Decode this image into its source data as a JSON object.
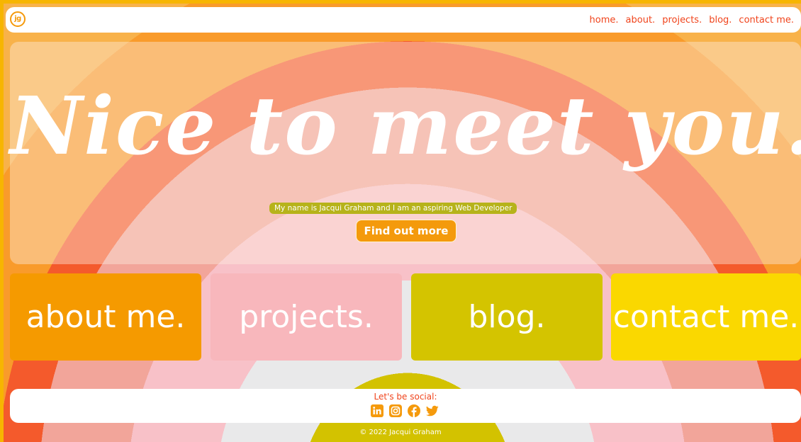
{
  "navbar": {
    "logo_text": "jg",
    "links": [
      "home.",
      "about.",
      "projects.",
      "blog.",
      "contact me."
    ]
  },
  "hero": {
    "title": "Nice to meet you.",
    "subtitle": "My name is Jacqui Graham and I am an aspiring Web Developer",
    "button_label": "Find out more"
  },
  "tiles": {
    "about": "about me.",
    "projects": "projects.",
    "blog": "blog.",
    "contact": "contact me."
  },
  "footer": {
    "social_title": "Let's be social:",
    "icons": [
      "linkedin-icon",
      "instagram-icon",
      "facebook-icon",
      "twitter-icon"
    ],
    "copyright": "© 2022 Jacqui Graham"
  },
  "colors": {
    "accent_orange": "#f59a0c",
    "nav_text": "#f0441c",
    "tile_about": "#f59a00",
    "tile_projects": "#f8b7bc",
    "tile_blog": "#d4c400",
    "tile_contact": "#fad800",
    "subtitle_bg": "#b6b31a"
  }
}
